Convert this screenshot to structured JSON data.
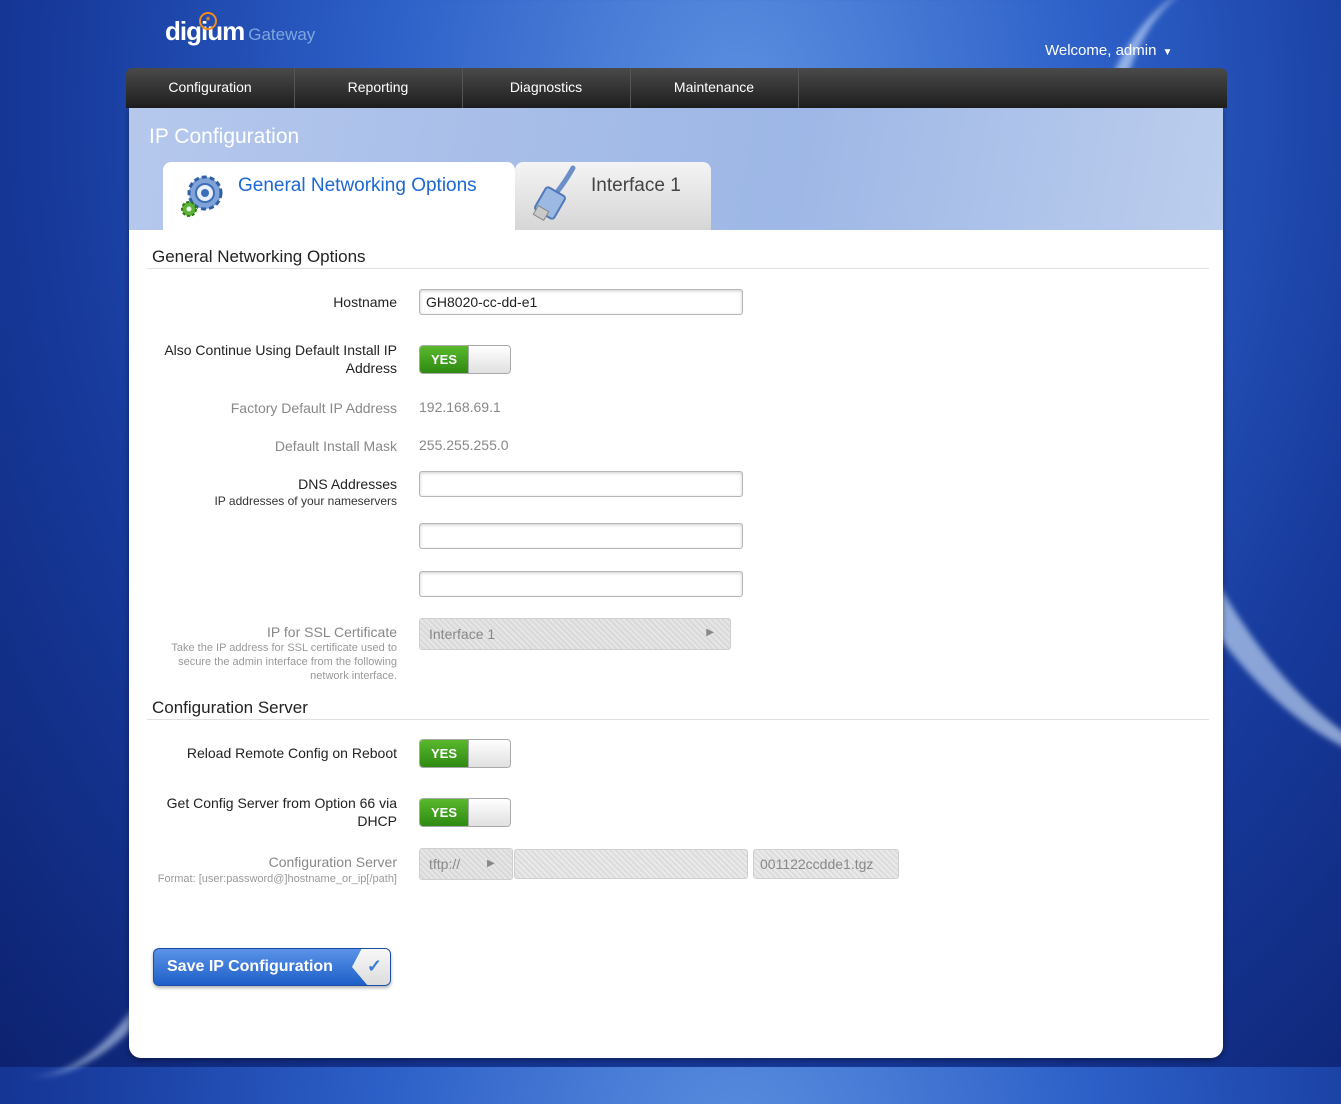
{
  "app": {
    "brand": "digium",
    "product": "Gateway"
  },
  "user": {
    "welcome": "Welcome, admin"
  },
  "nav": {
    "items": [
      "Configuration",
      "Reporting",
      "Diagnostics",
      "Maintenance"
    ]
  },
  "page": {
    "title": "IP Configuration"
  },
  "tabs": [
    "General Networking Options",
    "Interface 1"
  ],
  "general": {
    "section_title": "General Networking Options",
    "hostname": {
      "label": "Hostname",
      "value": "GH8020-cc-dd-e1"
    },
    "default_install_ip": {
      "label": "Also Continue Using Default Install IP Address",
      "toggle": "YES"
    },
    "factory_ip": {
      "label": "Factory Default IP Address",
      "value": "192.168.69.1"
    },
    "install_mask": {
      "label": "Default Install Mask",
      "value": "255.255.255.0"
    },
    "dns": {
      "label": "DNS Addresses",
      "help": "IP addresses of your nameservers",
      "values": [
        "",
        "",
        ""
      ]
    },
    "ssl": {
      "label": "IP for SSL Certificate",
      "help": "Take the IP address for SSL certificate used to secure the admin interface from the following network interface.",
      "value": "Interface 1"
    }
  },
  "config_server": {
    "section_title": "Configuration Server",
    "reload_on_reboot": {
      "label": "Reload Remote Config on Reboot",
      "toggle": "YES"
    },
    "option66": {
      "label": "Get Config Server from Option 66 via DHCP",
      "toggle": "YES"
    },
    "server": {
      "label": "Configuration Server",
      "help": "Format: [user:password@]hostname_or_ip[/path]",
      "protocol": "tftp://",
      "host": "",
      "filename": "001122ccdde1.tgz"
    }
  },
  "actions": {
    "save_label": "Save IP Configuration"
  },
  "colors": {
    "toggle_on": "#3f9e1f",
    "tab_active_text": "#1d68d2",
    "save_button": "#2a6fd6",
    "navbar": "#2b2b2b"
  }
}
